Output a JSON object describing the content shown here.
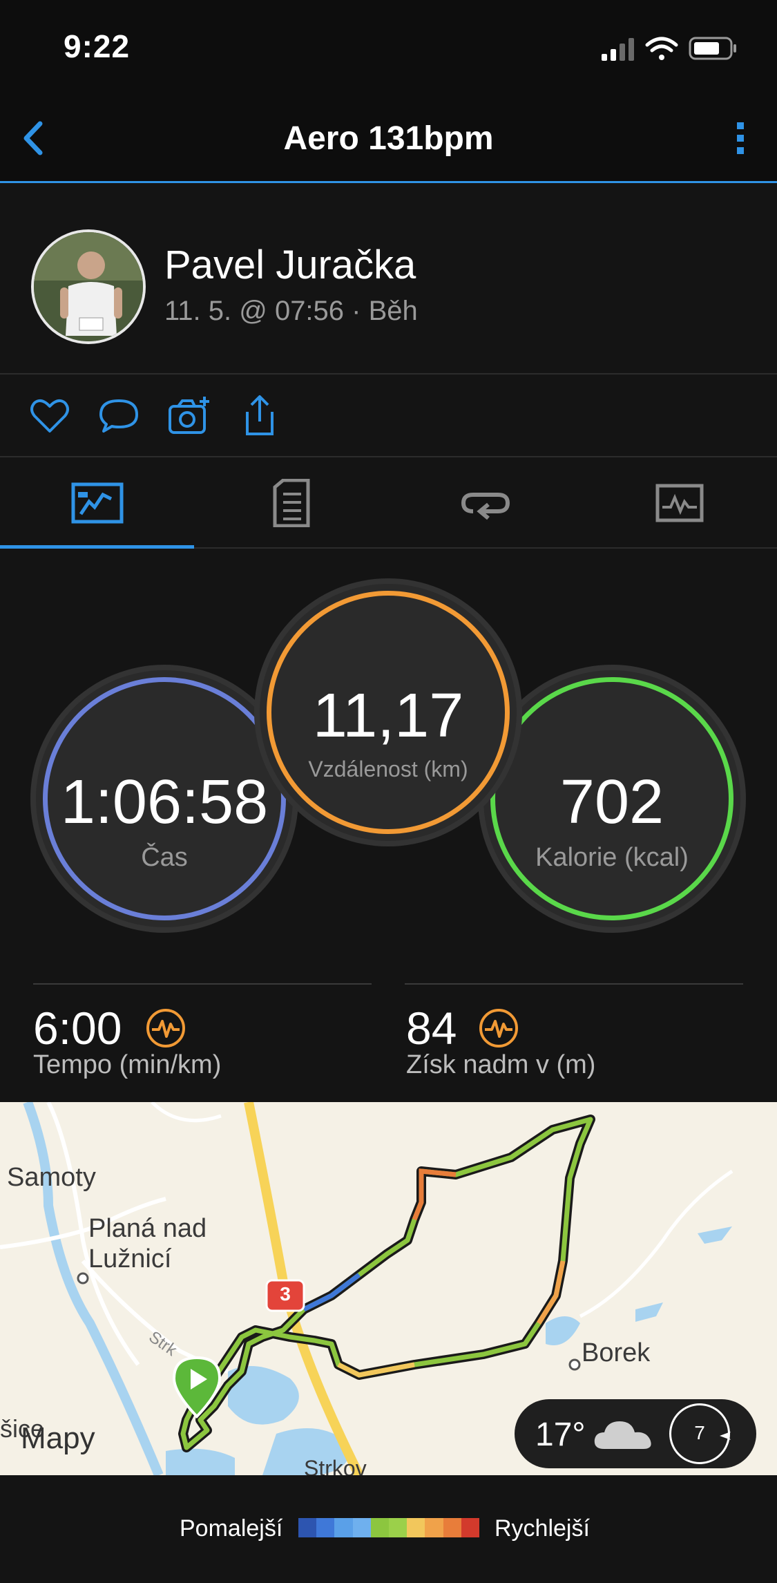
{
  "status_bar": {
    "time": "9:22"
  },
  "header": {
    "title": "Aero 131bpm"
  },
  "profile": {
    "name": "Pavel Juračka",
    "meta": "11. 5. @ 07:56 · Běh"
  },
  "actions": [
    "heart-icon",
    "comment-icon",
    "camera-add-icon",
    "share-icon"
  ],
  "tabs": [
    "summary-map-icon",
    "details-list-icon",
    "laps-icon",
    "graph-icon"
  ],
  "stats": {
    "time": {
      "value": "1:06:58",
      "label": "Čas"
    },
    "distance": {
      "value": "11,17",
      "label": "Vzdálenost (km)"
    },
    "calories": {
      "value": "702",
      "label": "Kalorie (kcal)"
    }
  },
  "metrics": {
    "pace": {
      "value": "6:00",
      "label": "Tempo (min/km)"
    },
    "elevation": {
      "value": "84",
      "label": "Získ nadm v (m)"
    }
  },
  "map": {
    "labels": {
      "samoty": "Samoty",
      "plana1": "Planá nad",
      "plana2": "Lužnicí",
      "borek": "Borek",
      "strkov": "Strkov",
      "strk": "Strk",
      "sice": "šice"
    },
    "road_badge": "3",
    "weather": {
      "temp": "17°",
      "wind": "7"
    },
    "attribution": "Mapy"
  },
  "legend": {
    "slower": "Pomalejší",
    "faster": "Rychlejší",
    "colors": [
      "#2d55b0",
      "#3f78d8",
      "#5aa0e8",
      "#6fb0ee",
      "#8cc63f",
      "#9bd04a",
      "#f2c75c",
      "#f0a24a",
      "#e87d3a",
      "#d23a2c"
    ]
  },
  "colors": {
    "accent": "#2f93e6",
    "time_ring": "#6a7fd8",
    "distance_ring": "#f29a35",
    "calories_ring": "#5ad84a"
  }
}
